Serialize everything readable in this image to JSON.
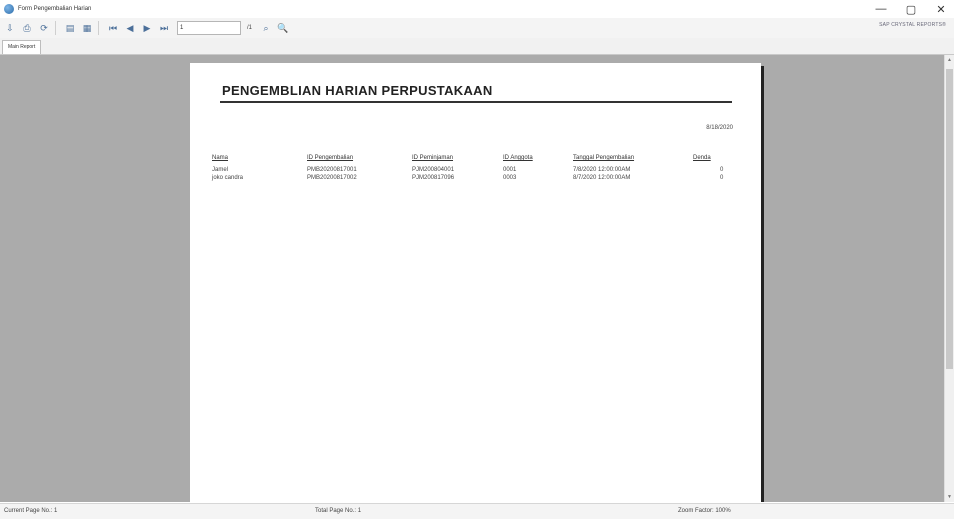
{
  "window": {
    "title": "Form Pengembalian Harian",
    "controls": {
      "minimize": "—",
      "maximize": "▢",
      "close": "✕"
    }
  },
  "toolbar": {
    "buttons": [
      "export-icon",
      "print-icon",
      "refresh-icon",
      "group-tree-icon",
      "page-setup-icon",
      "first-page-icon",
      "prev-page-icon",
      "next-page-icon",
      "last-page-icon"
    ],
    "page_input": "1",
    "page_of": "/1",
    "brand": "SAP CRYSTAL REPORTS®"
  },
  "tabs": {
    "main_report": "Main Report"
  },
  "report": {
    "title": "PENGEMBLIAN HARIAN PERPUSTAKAAN",
    "date": "8/18/2020",
    "columns": [
      "Nama",
      "ID Pengembalian",
      "ID Peminjaman",
      "ID Anggota",
      "Tanggal Pengembalian",
      "Denda"
    ],
    "rows": [
      [
        "Jamel",
        "PMB20200817001",
        "PJM200804001",
        "0001",
        "7/8/2020 12:00:00AM",
        "0"
      ],
      [
        "joko candra",
        "PMB20200817002",
        "PJM200817096",
        "0003",
        "8/7/2020 12:00:00AM",
        "0"
      ]
    ]
  },
  "status": {
    "current_page": "Current Page No.: 1",
    "total_page": "Total Page No.: 1",
    "zoom": "Zoom Factor: 100%"
  },
  "colors": {
    "viewport_bg": "#ababab",
    "toolbar_icon": "#4b6f99"
  }
}
